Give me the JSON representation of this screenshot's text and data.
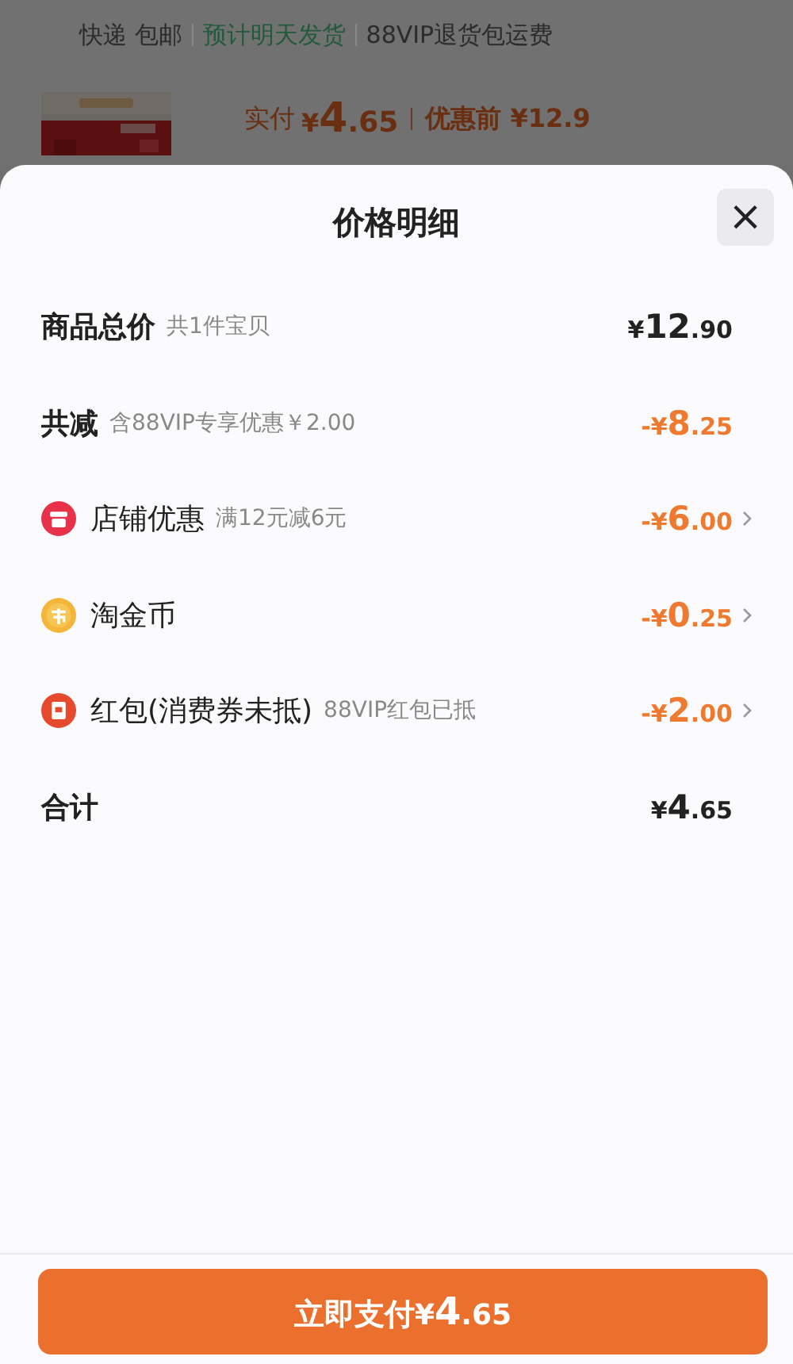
{
  "background": {
    "shipping": [
      "快递 包邮",
      "预计明天发货",
      "88VIP退货包运费"
    ],
    "paid_label": "实付",
    "paid_amount": "¥4.65",
    "original_price": "优惠前 ¥12.9"
  },
  "sheet": {
    "title": "价格明细",
    "close": "×",
    "rows": [
      {
        "kind": "summary",
        "label": "商品总价",
        "note": "共1件宝贝",
        "amount": "¥12.90"
      },
      {
        "kind": "reduction",
        "label": "共减",
        "note": "含88VIP专享优惠￥2.00",
        "amount": "-¥8.25"
      },
      {
        "kind": "detail",
        "label": "店铺优惠",
        "note": "满12元减6元",
        "amount": "-¥6.00"
      },
      {
        "kind": "detail",
        "label": "淘金币",
        "amount": "-¥0.25"
      },
      {
        "kind": "detail",
        "label": "红包(消费券未抵)",
        "note": "88VIP红包已抵",
        "amount": "-¥2.00"
      },
      {
        "kind": "summary",
        "label": "合计",
        "amount": "¥4.65"
      }
    ],
    "pay_button": "立即支付¥4.65"
  }
}
